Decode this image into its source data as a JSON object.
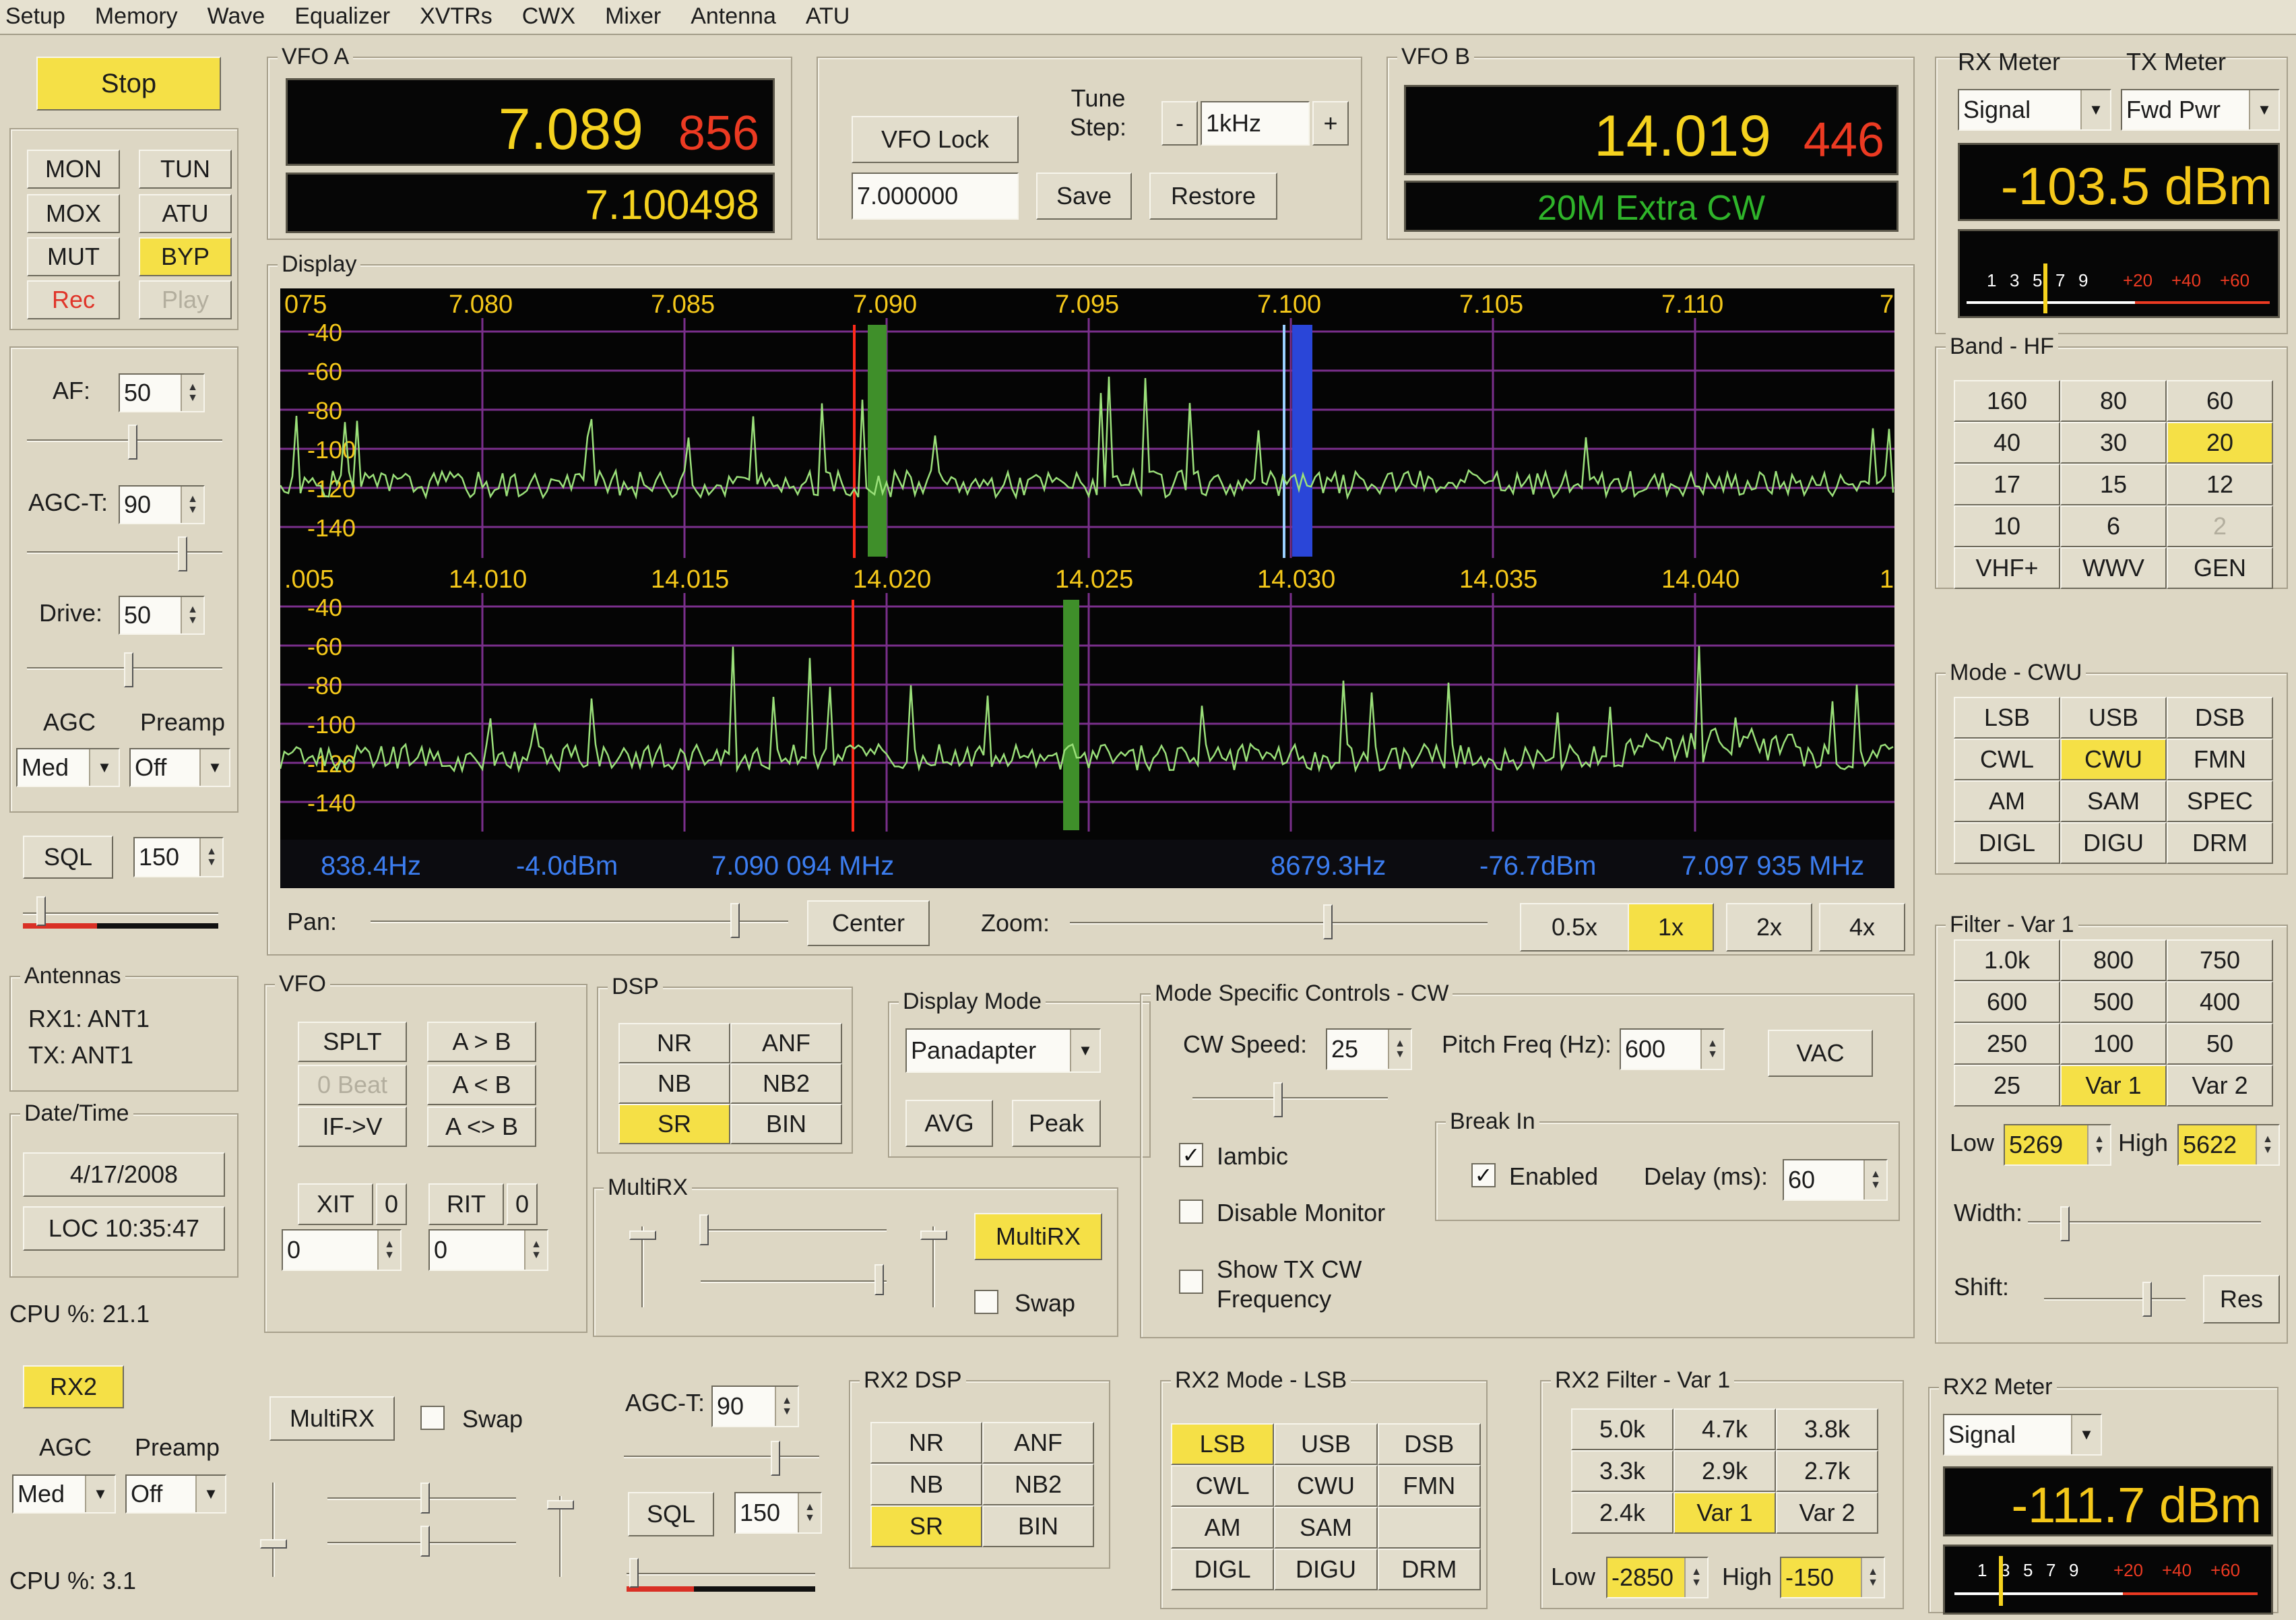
{
  "menu": [
    "Setup",
    "Memory",
    "Wave",
    "Equalizer",
    "XVTRs",
    "CWX",
    "Mixer",
    "Antenna",
    "ATU"
  ],
  "left": {
    "stop": "Stop",
    "buttons": [
      "MON",
      "TUN",
      "MOX",
      "ATU",
      "MUT",
      "BYP",
      "Rec",
      "Play"
    ],
    "af_label": "AF:",
    "af": "50",
    "agct_label": "AGC-T:",
    "agct": "90",
    "drive_label": "Drive:",
    "drive": "50",
    "agc_label": "AGC",
    "agc": "Med",
    "preamp_label": "Preamp",
    "preamp": "Off",
    "sql_label": "SQL",
    "sql": "150",
    "antennas_title": "Antennas",
    "rx1": "RX1: ANT1",
    "tx": "TX: ANT1",
    "datetime_title": "Date/Time",
    "date": "4/17/2008",
    "time": "LOC 10:35:47",
    "cpu": "CPU %: 21.1",
    "rx2": "RX2",
    "agc2_label": "AGC",
    "preamp2_label": "Preamp",
    "agc2": "Med",
    "preamp2": "Off",
    "cpu2": "CPU %: 3.1"
  },
  "vfoa": {
    "title": "VFO A",
    "main": "7.089",
    "sub": "856",
    "second": "7.100498"
  },
  "vfolock": {
    "lock": "VFO Lock",
    "tune_label": "Tune\nStep:",
    "step": "1kHz",
    "minus": "-",
    "plus": "+",
    "freq": "7.000000",
    "save": "Save",
    "restore": "Restore"
  },
  "vfob": {
    "title": "VFO B",
    "main": "14.019",
    "sub": "446",
    "band": "20M Extra CW"
  },
  "meters": {
    "rx_title": "RX Meter",
    "tx_title": "TX Meter",
    "rx_sel": "Signal",
    "tx_sel": "Fwd Pwr",
    "value": "-103.5 dBm",
    "scale_white": [
      "1",
      "3",
      "5",
      "7",
      "9"
    ],
    "scale_red": [
      "+20",
      "+40",
      "+60"
    ]
  },
  "display": {
    "title": "Display",
    "top_ticks": [
      "075",
      "7.080",
      "7.085",
      "7.090",
      "7.095",
      "7.100",
      "7.105",
      "7.110",
      "7"
    ],
    "bot_ticks": [
      ".005",
      "14.010",
      "14.015",
      "14.020",
      "14.025",
      "14.030",
      "14.035",
      "14.040",
      "1"
    ],
    "dbm": [
      "-40",
      "-60",
      "-80",
      "-100",
      "-120",
      "-140"
    ],
    "status": [
      "838.4Hz",
      "-4.0dBm",
      "7.090 094 MHz",
      "8679.3Hz",
      "-76.7dBm",
      "7.097 935 MHz"
    ],
    "pan": "Pan:",
    "center": "Center",
    "zoom": "Zoom:",
    "zooms": [
      "0.5x",
      "1x",
      "2x",
      "4x"
    ]
  },
  "band": {
    "title": "Band - HF",
    "items": [
      "160",
      "80",
      "60",
      "40",
      "30",
      "20",
      "17",
      "15",
      "12",
      "10",
      "6",
      "2",
      "VHF+",
      "WWV",
      "GEN"
    ]
  },
  "mode": {
    "title": "Mode - CWU",
    "items": [
      "LSB",
      "USB",
      "DSB",
      "CWL",
      "CWU",
      "FMN",
      "AM",
      "SAM",
      "SPEC",
      "DIGL",
      "DIGU",
      "DRM"
    ]
  },
  "filter": {
    "title": "Filter - Var 1",
    "items": [
      "1.0k",
      "800",
      "750",
      "600",
      "500",
      "400",
      "250",
      "100",
      "50",
      "25",
      "Var 1",
      "Var 2"
    ],
    "low_label": "Low",
    "low": "5269",
    "high_label": "High",
    "high": "5622",
    "width": "Width:",
    "shift": "Shift:",
    "res": "Res"
  },
  "vfo": {
    "title": "VFO",
    "buttons": [
      "SPLT",
      "A > B",
      "0 Beat",
      "A < B",
      "IF->V",
      "A <> B"
    ],
    "xit": "XIT",
    "xit_val": "0",
    "rit": "RIT",
    "rit_val": "0",
    "xit_field": "0",
    "rit_field": "0"
  },
  "dsp": {
    "title": "DSP",
    "items": [
      "NR",
      "ANF",
      "NB",
      "NB2",
      "SR",
      "BIN"
    ]
  },
  "dispmode": {
    "title": "Display Mode",
    "sel": "Panadapter",
    "avg": "AVG",
    "peak": "Peak"
  },
  "mrx": {
    "title": "MultiRX",
    "btn": "MultiRX",
    "swap": "Swap"
  },
  "msc": {
    "title": "Mode Specific Controls - CW",
    "cw_speed": "CW Speed:",
    "cw_val": "25",
    "pitch": "Pitch Freq (Hz):",
    "pitch_val": "600",
    "vac": "VAC",
    "iambic": "Iambic",
    "disable": "Disable Monitor",
    "show1": "Show TX CW",
    "show2": "Frequency",
    "break_title": "Break In",
    "enabled": "Enabled",
    "delay": "Delay (ms):",
    "delay_val": "60"
  },
  "rx2row": {
    "multirx": "MultiRX",
    "swap": "Swap",
    "agct_label": "AGC-T:",
    "agct": "90",
    "sql": "SQL",
    "sql_val": "150"
  },
  "rx2dsp": {
    "title": "RX2 DSP",
    "items": [
      "NR",
      "ANF",
      "NB",
      "NB2",
      "SR",
      "BIN"
    ]
  },
  "rx2mode": {
    "title": "RX2 Mode - LSB",
    "items": [
      "LSB",
      "USB",
      "DSB",
      "CWL",
      "CWU",
      "FMN",
      "AM",
      "SAM",
      "",
      "DIGL",
      "DIGU",
      "DRM"
    ]
  },
  "rx2filter": {
    "title": "RX2 Filter - Var 1",
    "items": [
      "5.0k",
      "4.7k",
      "3.8k",
      "3.3k",
      "2.9k",
      "2.7k",
      "2.4k",
      "Var 1",
      "Var 2"
    ],
    "low_label": "Low",
    "low": "-2850",
    "high_label": "High",
    "high": "-150"
  },
  "rx2meter": {
    "title": "RX2 Meter",
    "sel": "Signal",
    "value": "-111.7 dBm",
    "scale_white": [
      "1",
      "3",
      "5",
      "7",
      "9"
    ],
    "scale_red": [
      "+20",
      "+40",
      "+60"
    ]
  },
  "colors": {
    "active": "#f5e046",
    "vfo_main": "#f5d21e",
    "vfo_sub": "#ec3a22",
    "band_text": "#2fb42a",
    "meter": "#f5c81a",
    "grid": "#7a2f8c",
    "trace": "#9be07a",
    "status": "#3c7df0"
  }
}
